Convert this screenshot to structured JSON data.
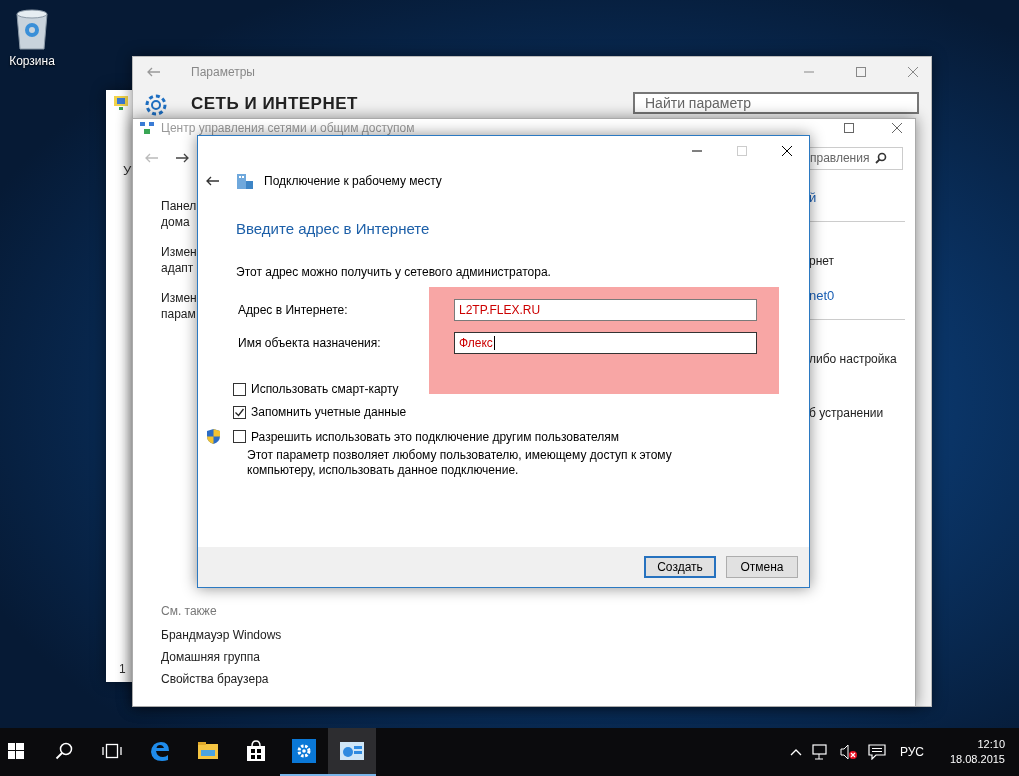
{
  "desktop": {
    "icons": [
      {
        "label": "Корзина"
      }
    ]
  },
  "background_window": {
    "texts": [
      "У",
      "1"
    ]
  },
  "settings_window": {
    "title": "Параметры",
    "heading": "СЕТЬ И ИНТЕРНЕТ",
    "search": {
      "placeholder": "Найти параметр"
    }
  },
  "network_center": {
    "title": "Центр управления сетями и общим доступом",
    "search": {
      "placeholder": "правления"
    },
    "left_pane": [
      {
        "lines": [
          "Панел",
          "дома"
        ]
      },
      {
        "lines": [
          "Измен",
          "адапт"
        ]
      },
      {
        "lines": [
          "Измен",
          "парам"
        ]
      }
    ],
    "right_pane": [
      {
        "kind": "link",
        "text": "й"
      },
      {
        "kind": "divider"
      },
      {
        "kind": "text",
        "text": "рнет"
      },
      {
        "kind": "link",
        "text": "net0"
      },
      {
        "kind": "divider"
      },
      {
        "kind": "text",
        "text": "либо настройка"
      },
      {
        "kind": "text",
        "text": "б устранении"
      }
    ],
    "see_also": {
      "heading": "См. также",
      "links": [
        "Брандмауэр Windows",
        "Домашняя группа",
        "Свойства браузера"
      ]
    }
  },
  "dialog": {
    "title": "Подключение к рабочему месту",
    "heading": "Введите адрес в Интернете",
    "hint": "Этот адрес можно получить у сетевого администратора.",
    "fields": [
      {
        "label": "Адрес в Интернете:",
        "value": "L2TP.FLEX.RU",
        "focused": false
      },
      {
        "label": "Имя объекта назначения:",
        "value": "Флекс",
        "focused": true
      }
    ],
    "checkboxes": [
      {
        "label": "Использовать смарт-карту",
        "checked": false,
        "shield": false
      },
      {
        "label": "Запомнить учетные данные",
        "checked": true,
        "shield": false
      },
      {
        "label": "Разрешить использовать это подключение другим пользователям",
        "checked": false,
        "shield": true
      }
    ],
    "description": "Этот параметр позволяет любому пользователю, имеющему доступ к этому компьютеру, использовать данное подключение.",
    "buttons": [
      {
        "label": "Создать",
        "default": true
      },
      {
        "label": "Отмена",
        "default": false
      }
    ]
  },
  "taskbar": {
    "apps": [
      {
        "kind": "start",
        "open": false,
        "selected": false
      },
      {
        "kind": "search",
        "open": false,
        "selected": false
      },
      {
        "kind": "taskview",
        "open": false,
        "selected": false
      },
      {
        "kind": "edge",
        "open": false,
        "selected": false
      },
      {
        "kind": "explorer",
        "open": false,
        "selected": false
      },
      {
        "kind": "store",
        "open": false,
        "selected": false
      },
      {
        "kind": "settings",
        "open": true,
        "selected": false
      },
      {
        "kind": "network",
        "open": true,
        "selected": true
      }
    ],
    "language": "РУС",
    "time": "12:10",
    "date": "18.08.2015"
  }
}
